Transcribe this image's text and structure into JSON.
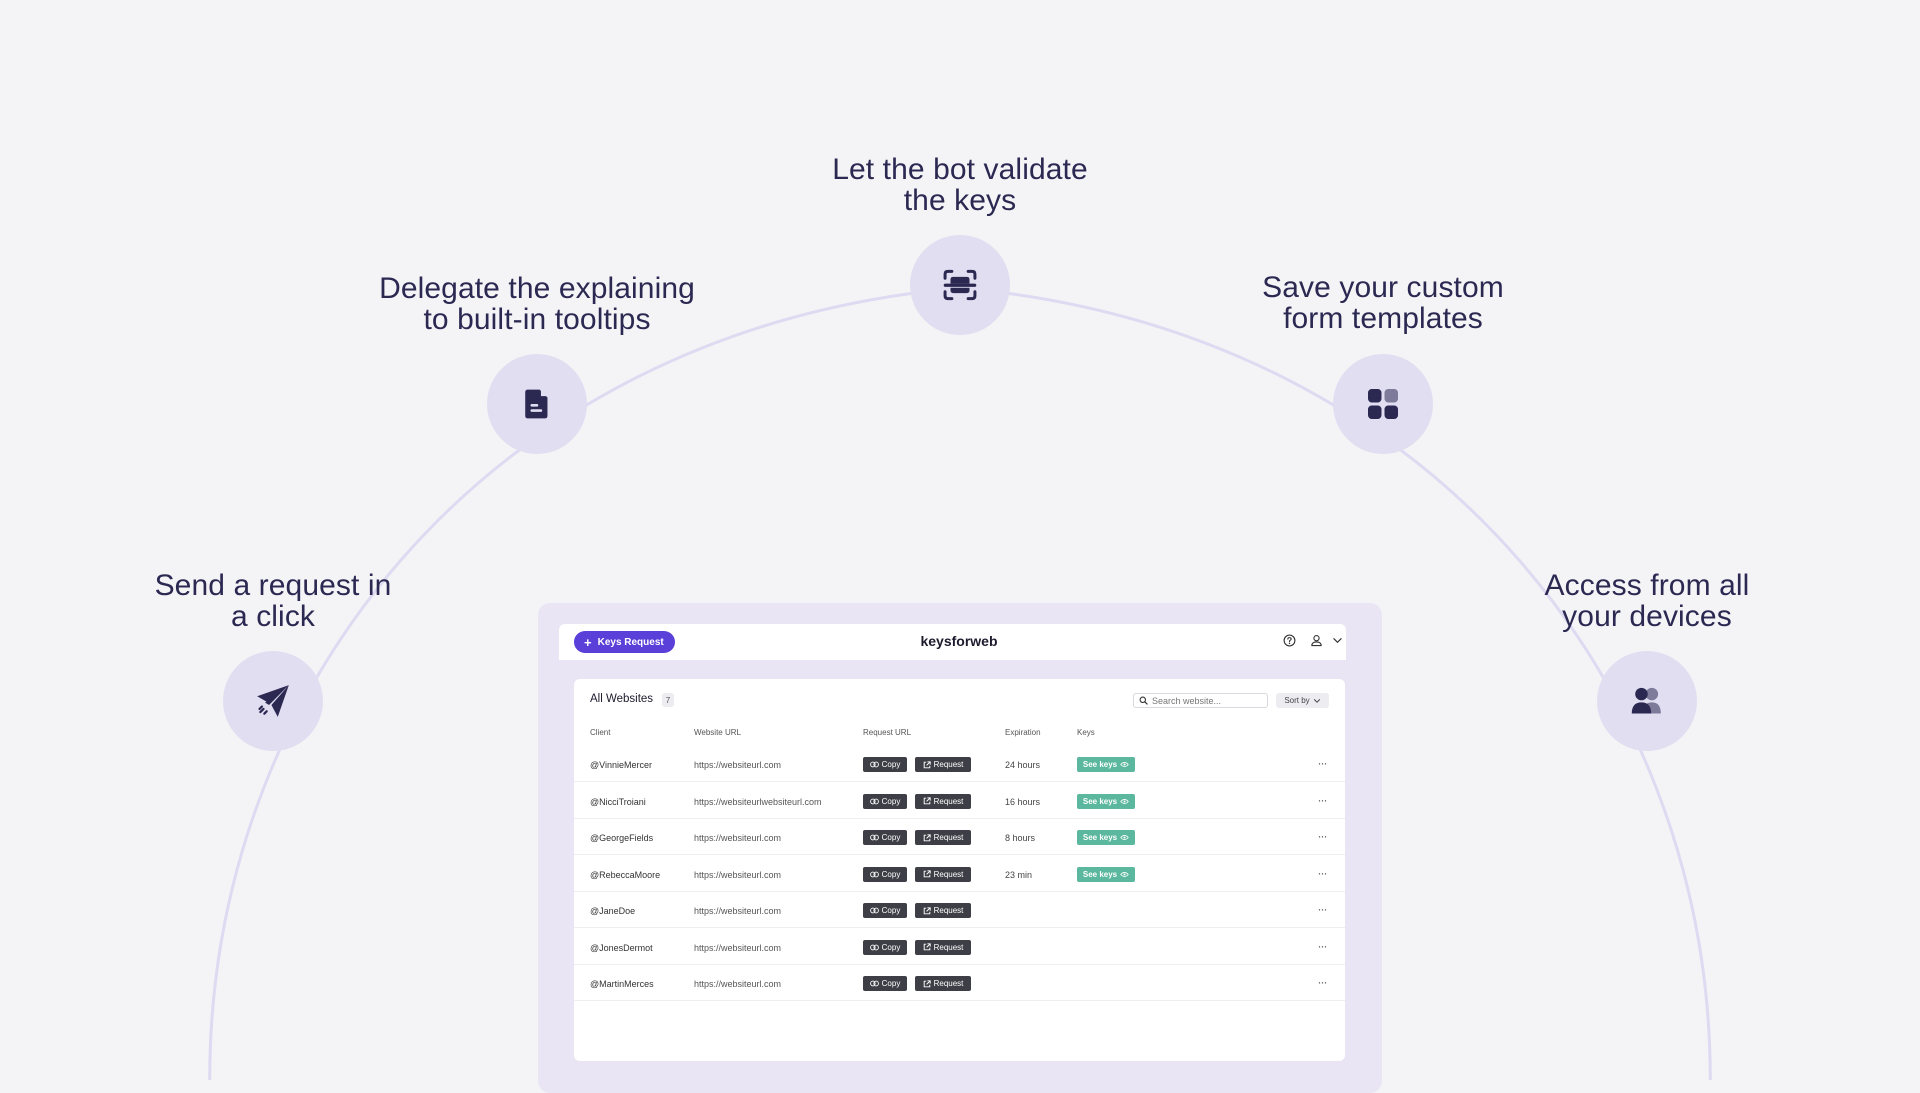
{
  "features": [
    {
      "title": "Send a request in\na click",
      "icon": "paper-plane-icon"
    },
    {
      "title": "Delegate the explaining\nto built-in tooltips",
      "icon": "document-icon"
    },
    {
      "title": "Let the bot validate\nthe keys",
      "icon": "scan-robot-icon"
    },
    {
      "title": "Save your custom\nform templates",
      "icon": "grid-templates-icon"
    },
    {
      "title": "Access from all\nyour devices",
      "icon": "users-icon"
    }
  ],
  "app": {
    "brand": "keysforweb",
    "keys_request_label": "Keys Request",
    "header_icons": [
      "help-circle-icon",
      "user-icon",
      "chevron-down-icon"
    ],
    "panel_title": "All Websites",
    "count": "7",
    "search_placeholder": "Search website...",
    "sort_label": "Sort by",
    "columns": {
      "client": "Client",
      "website_url": "Website URL",
      "request_url": "Request URL",
      "expiration": "Expiration",
      "keys": "Keys"
    },
    "copy_label": "Copy",
    "request_label": "Request",
    "see_keys_label": "See keys",
    "more_label": "···",
    "rows": [
      {
        "client": "@VinnieMercer",
        "url": "https://websiteurl.com",
        "expiration": "24 hours",
        "has_keys": true
      },
      {
        "client": "@NicciTroiani",
        "url": "https://websiteurlwebsiteurl.com",
        "expiration": "16 hours",
        "has_keys": true
      },
      {
        "client": "@GeorgeFields",
        "url": "https://websiteurl.com",
        "expiration": "8 hours",
        "has_keys": true
      },
      {
        "client": "@RebeccaMoore",
        "url": "https://websiteurl.com",
        "expiration": "23 min",
        "has_keys": true
      },
      {
        "client": "@JaneDoe",
        "url": "https://websiteurl.com",
        "expiration": "",
        "has_keys": false
      },
      {
        "client": "@JonesDermot",
        "url": "https://websiteurl.com",
        "expiration": "",
        "has_keys": false
      },
      {
        "client": "@MartinMerces",
        "url": "https://websiteurl.com",
        "expiration": "",
        "has_keys": false
      }
    ]
  },
  "colors": {
    "background": "#f4f4f6",
    "arc": "#dedaf1",
    "circle": "#e1def1",
    "icon": "#2b2852",
    "accent": "#5b3fd9",
    "see_keys": "#5bb79d",
    "dark_button": "#3e3e46"
  }
}
